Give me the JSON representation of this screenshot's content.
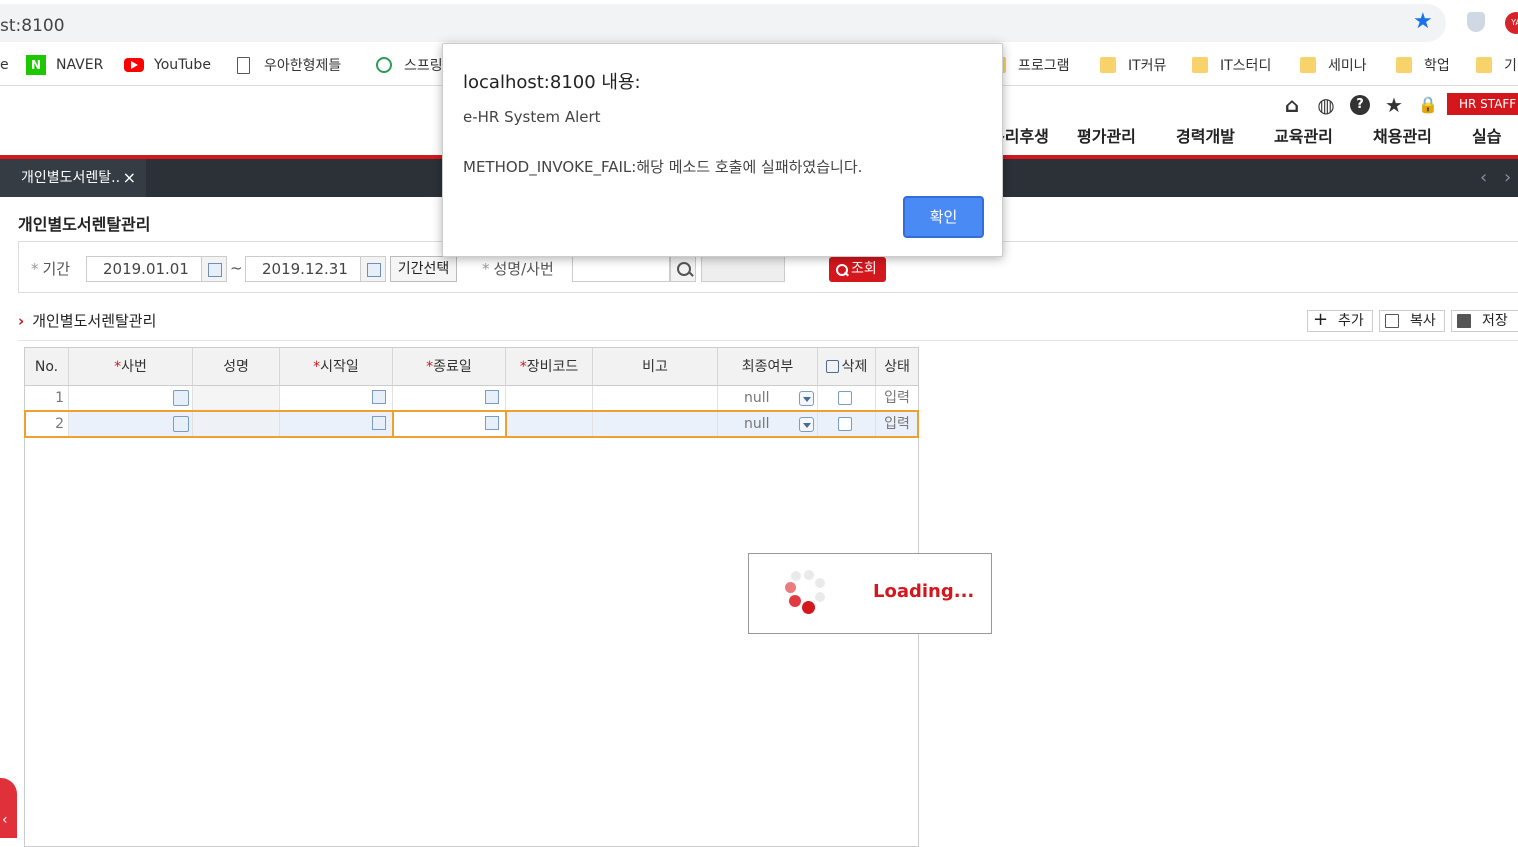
{
  "browser": {
    "url_fragment": "st:8100",
    "bookmarks": [
      {
        "label": "e",
        "icon": "text-fragment"
      },
      {
        "label": "NAVER",
        "icon": "naver-icon"
      },
      {
        "label": "YouTube",
        "icon": "youtube-icon"
      },
      {
        "label": "우아한형제들",
        "icon": "page-icon"
      },
      {
        "label": "스프링",
        "icon": "spring-icon"
      },
      {
        "label": "프로그램",
        "icon": "folder-icon"
      },
      {
        "label": "IT커뮤",
        "icon": "folder-icon"
      },
      {
        "label": "IT스터디",
        "icon": "folder-icon"
      },
      {
        "label": "세미나",
        "icon": "folder-icon"
      },
      {
        "label": "학업",
        "icon": "folder-icon"
      },
      {
        "label": "기",
        "icon": "folder-icon"
      }
    ]
  },
  "header": {
    "hr_staff_badge": "HR STAFF",
    "menu": [
      "복리후생",
      "평가관리",
      "경력개발",
      "교육관리",
      "채용관리",
      "실습"
    ]
  },
  "tabs": [
    {
      "label": "개인별도서렌탈..",
      "close": "×"
    }
  ],
  "page": {
    "title": "개인별도서렌탈관리",
    "search": {
      "period_label": "기간",
      "start_date": "2019.01.01",
      "tilde": "~",
      "end_date": "2019.12.31",
      "period_select_button": "기간선택",
      "name_label": "성명/사번",
      "search_button": "조회"
    },
    "section_title": "개인별도서렌탈관리",
    "actions": {
      "add": "추가",
      "copy": "복사",
      "save": "저장"
    }
  },
  "grid": {
    "columns": [
      "No.",
      "사번",
      "성명",
      "시작일",
      "종료일",
      "장비코드",
      "비고",
      "최종여부",
      "삭제",
      "상태"
    ],
    "required_mark": "*",
    "rows": [
      {
        "no": "1",
        "final": "null",
        "status": "입력"
      },
      {
        "no": "2",
        "final": "null",
        "status": "입력"
      }
    ]
  },
  "loading": {
    "text": "Loading..."
  },
  "dialog": {
    "title": "localhost:8100 내용:",
    "line1": "e-HR System Alert",
    "line2": "METHOD_INVOKE_FAIL:해당 메소드 호출에 실패하였습니다.",
    "ok_button": "확인"
  },
  "colors": {
    "accent_red": "#d4161d",
    "dialog_button": "#4a8af4",
    "tabbar_bg": "#2c3138"
  }
}
